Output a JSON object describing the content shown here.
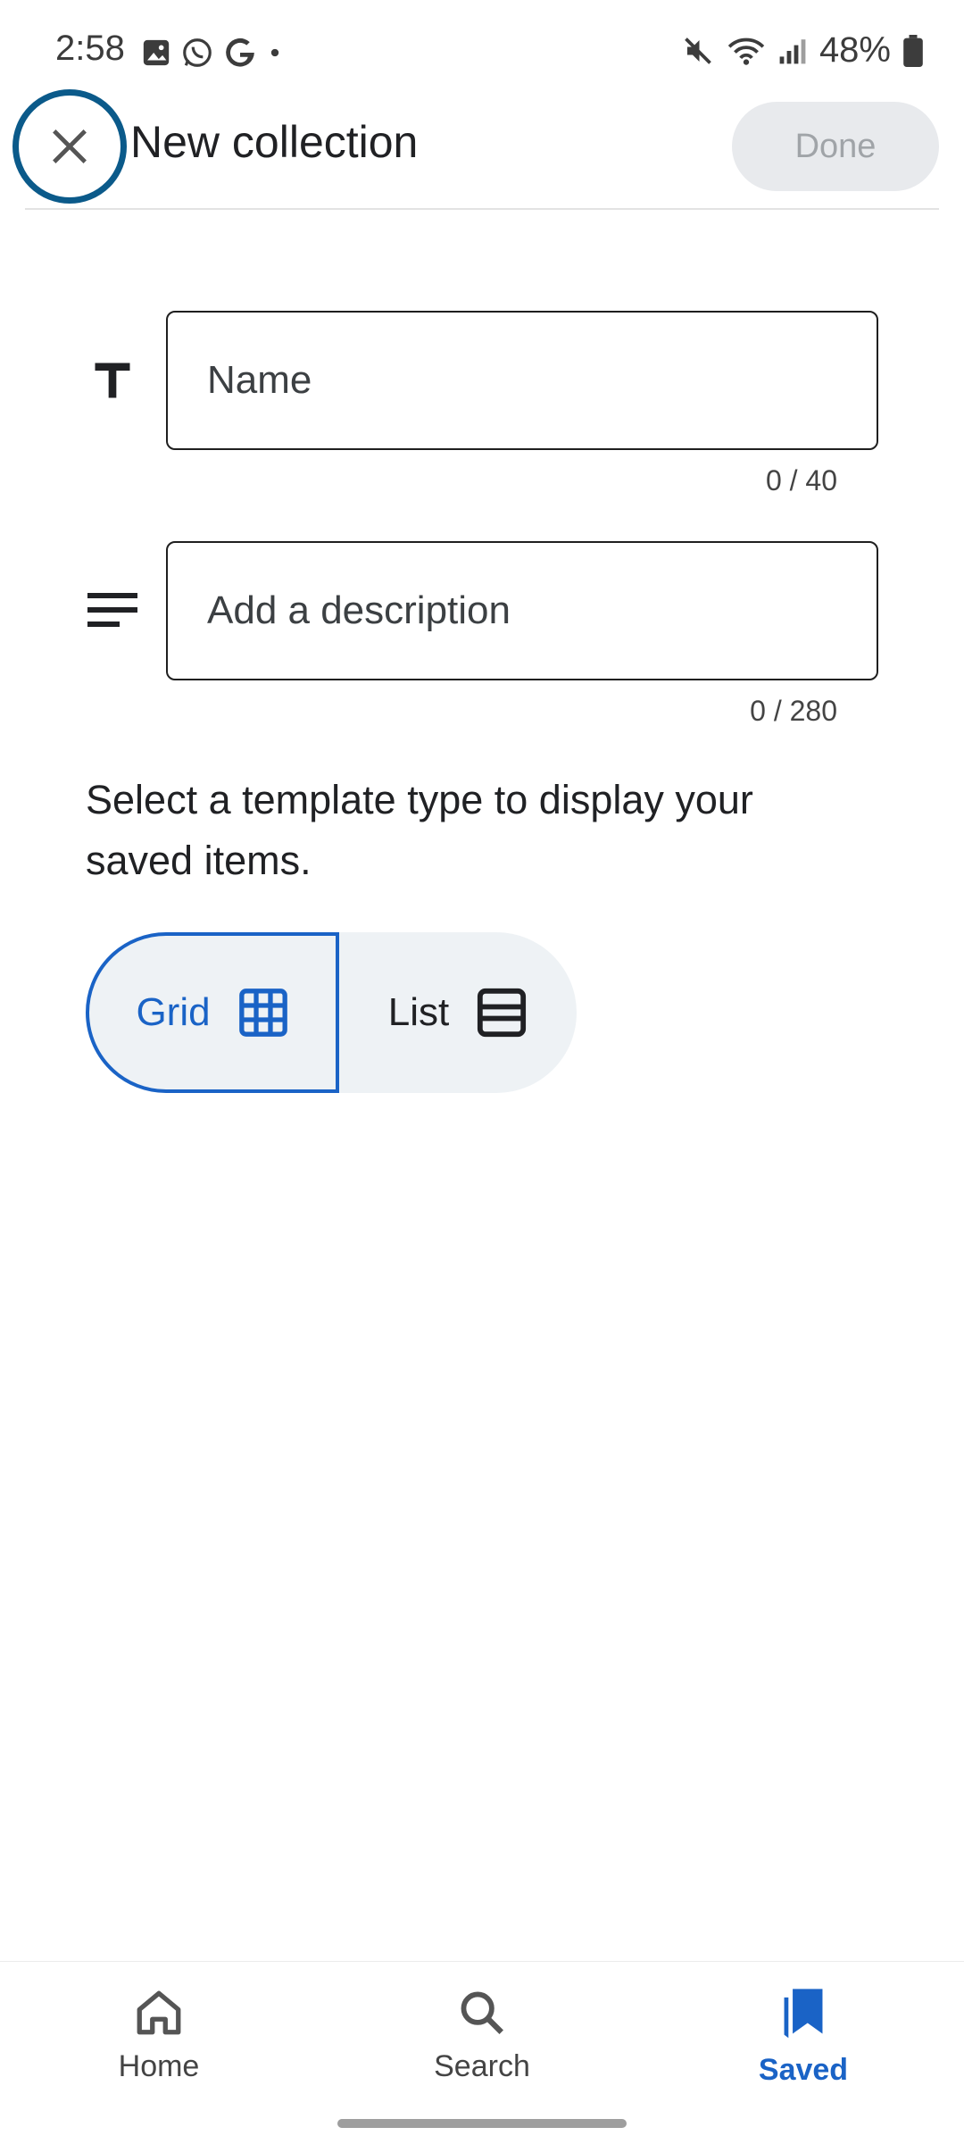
{
  "status_bar": {
    "time": "2:58",
    "battery": "48%"
  },
  "header": {
    "title": "New collection",
    "done_label": "Done"
  },
  "fields": {
    "name_placeholder": "Name",
    "name_counter": "0 / 40",
    "description_placeholder": "Add a description",
    "description_counter": "0 / 280"
  },
  "template": {
    "prompt": "Select a template type to display your saved items.",
    "options": [
      {
        "label": "Grid",
        "icon": "grid-icon",
        "selected": true
      },
      {
        "label": "List",
        "icon": "list-icon",
        "selected": false
      }
    ]
  },
  "bottom_nav": {
    "items": [
      {
        "label": "Home",
        "icon": "home-icon",
        "active": false
      },
      {
        "label": "Search",
        "icon": "search-icon",
        "active": false
      },
      {
        "label": "Saved",
        "icon": "bookmark-icon",
        "active": true
      }
    ]
  },
  "colors": {
    "accent": "#1a63c6",
    "close_ring": "#0b5a8a",
    "done_bg": "#e8eaed"
  }
}
